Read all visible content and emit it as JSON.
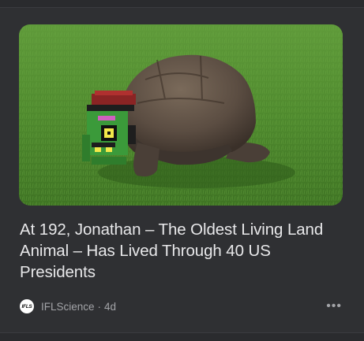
{
  "article": {
    "headline": "At 192, Jonathan – The Oldest Living Land Animal – Has Lived Through 40 US Presidents",
    "thumbnail_alt": "Jonathan the tortoise on grass"
  },
  "source": {
    "logo_text": "IFLS",
    "name": "IFLScience",
    "separator": "·",
    "age": "4d"
  },
  "more_menu": {
    "icon": "more-horizontal-icon",
    "glyph": "•••"
  },
  "colors": {
    "background": "#2f3033",
    "headline": "#e8e8ea",
    "meta": "#a3a4a8"
  }
}
